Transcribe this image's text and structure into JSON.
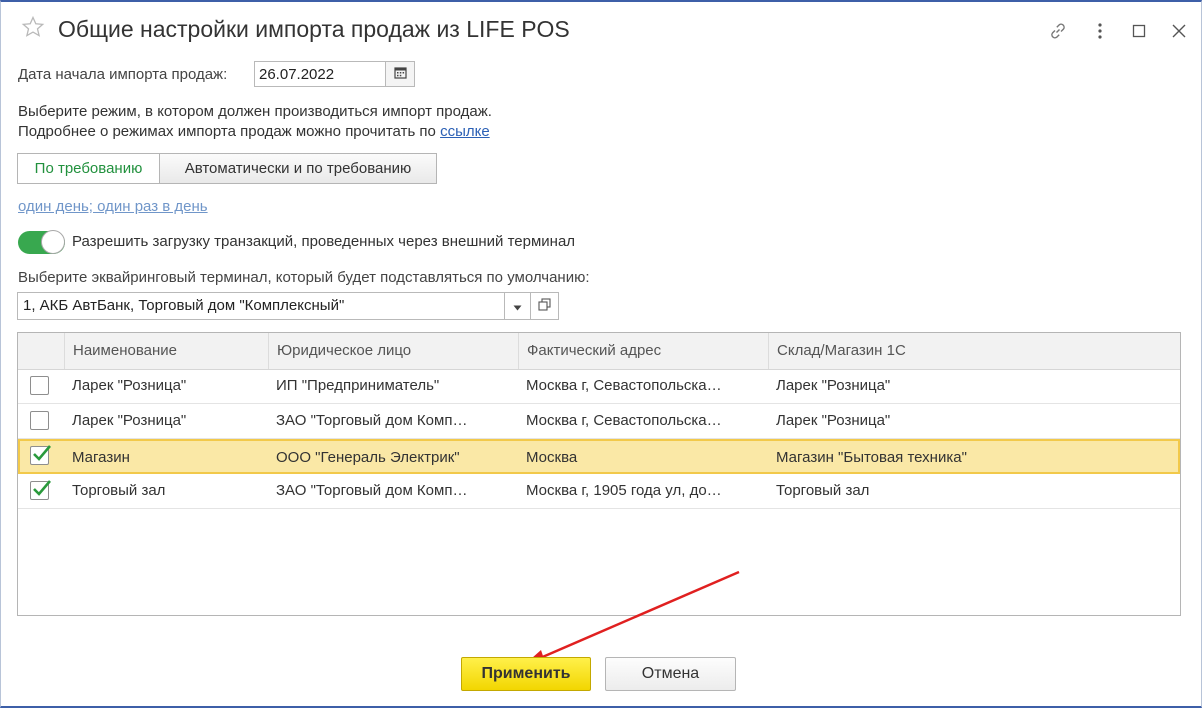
{
  "window": {
    "title": "Общие настройки импорта продаж из LIFE POS"
  },
  "import_start": {
    "label": "Дата начала импорта продаж:",
    "value": "26.07.2022"
  },
  "mode_info": {
    "line1": "Выберите режим, в котором должен производиться импорт продаж.",
    "line2_prefix": "Подробнее о режимах импорта продаж можно прочитать по",
    "link_text": "ссылке"
  },
  "mode_switch": {
    "options": [
      "По требованию",
      "Автоматически и по требованию"
    ],
    "selected": "По требованию"
  },
  "schedule_link": "один день; один раз в день",
  "external_terminal": {
    "enabled": true,
    "label": "Разрешить загрузку транзакций, проведенных через внешний терминал"
  },
  "terminal_select": {
    "label": "Выберите эквайринговый терминал, который будет подставляться по умолчанию:",
    "value": "1, АКБ АвтБанк, Торговый дом \"Комплексный\""
  },
  "table": {
    "columns": [
      "Наименование",
      "Юридическое лицо",
      "Фактический адрес",
      "Склад/Магазин 1С"
    ],
    "rows": [
      {
        "checked": false,
        "name": "Ларек \"Розница\"",
        "entity": "ИП \"Предприниматель\"",
        "address": "Москва г, Севастопольска…",
        "store": "Ларек \"Розница\""
      },
      {
        "checked": false,
        "name": "Ларек \"Розница\"",
        "entity": "ЗАО \"Торговый дом Комп…",
        "address": "Москва г, Севастопольска…",
        "store": "Ларек \"Розница\""
      },
      {
        "checked": true,
        "selected": true,
        "name": "Магазин",
        "entity": "ООО \"Генераль Электрик\"",
        "address": "Москва",
        "store": "Магазин \"Бытовая техника\""
      },
      {
        "checked": true,
        "name": "Торговый зал",
        "entity": "ЗАО \"Торговый дом Комп…",
        "address": "Москва г, 1905 года ул, до…",
        "store": "Торговый зал"
      }
    ]
  },
  "buttons": {
    "apply": "Применить",
    "cancel": "Отмена"
  },
  "colors": {
    "accent_green": "#38a84f",
    "apply_yellow": "#f7e01c",
    "selected_row": "#fae8a6",
    "link_blue": "#2b60b5",
    "annotation_arrow": "#e02020"
  },
  "icons": [
    "star-icon",
    "link-icon",
    "more-icon",
    "maximize-icon",
    "close-icon",
    "calendar-icon",
    "dropdown-arrow-icon",
    "open-form-icon",
    "checkmark-icon"
  ]
}
